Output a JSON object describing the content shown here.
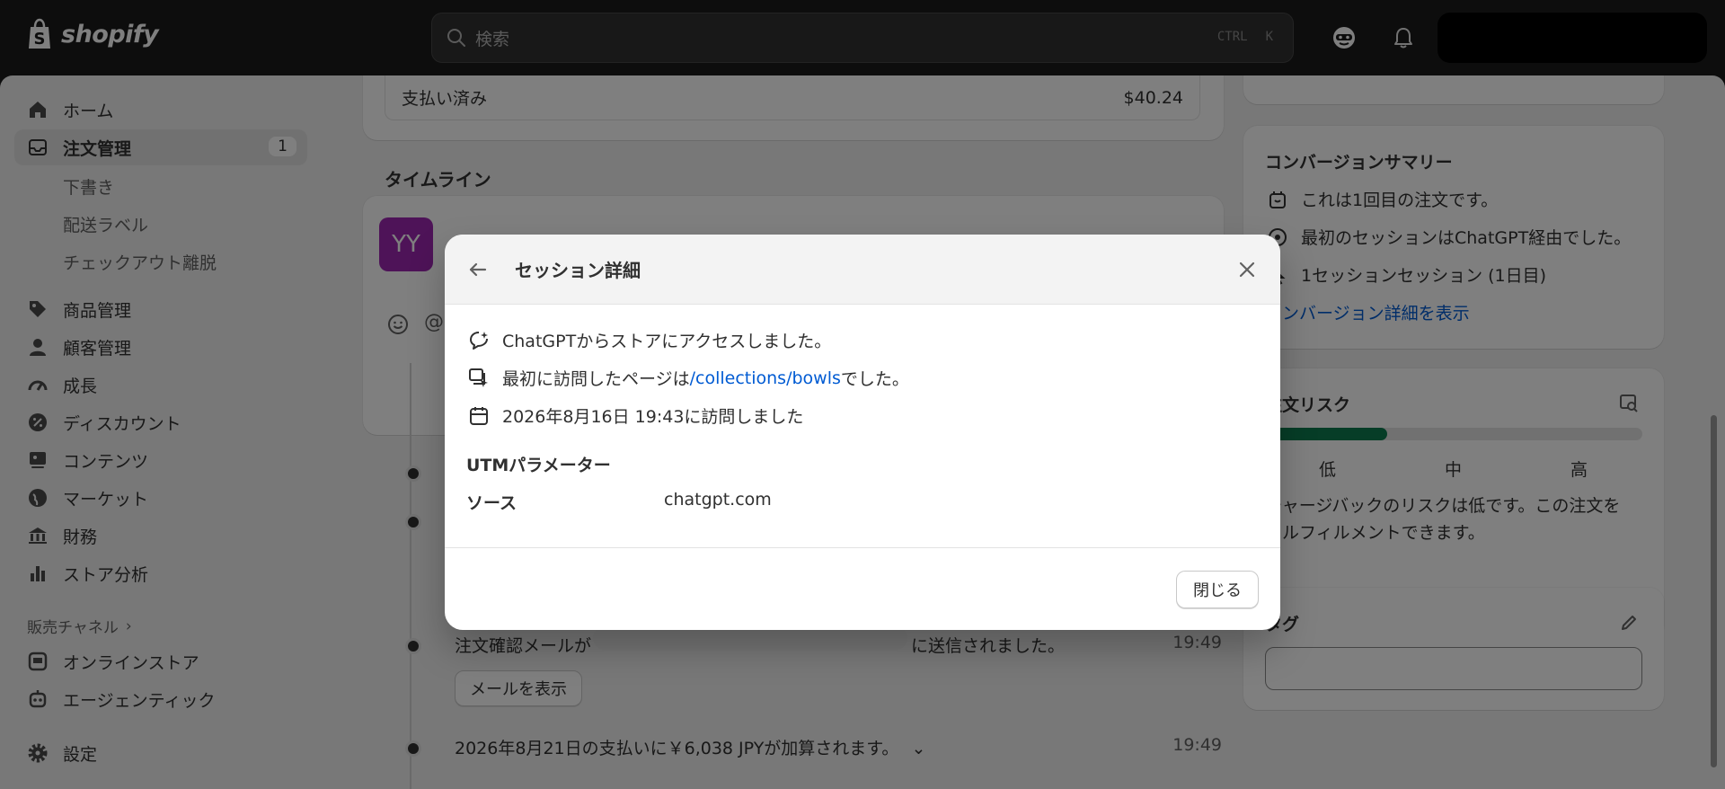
{
  "topbar": {
    "logo_text": "shopify",
    "search_placeholder": "検索",
    "shortcut_ctrl": "CTRL",
    "shortcut_key": "K"
  },
  "sidebar": {
    "home": "ホーム",
    "orders": "注文管理",
    "orders_badge": "1",
    "drafts": "下書き",
    "shipping_labels": "配送ラベル",
    "abandoned_checkouts": "チェックアウト離脱",
    "products": "商品管理",
    "customers": "顧客管理",
    "growth": "成長",
    "discounts": "ディスカウント",
    "content": "コンテンツ",
    "markets": "マーケット",
    "finance": "財務",
    "analytics": "ストア分析",
    "sales_channels": "販売チャネル",
    "online_store": "オンラインストア",
    "agentic": "エージェンティック",
    "settings": "設定"
  },
  "main": {
    "paid_label": "支払い済み",
    "paid_amount": "$40.24",
    "timeline_title": "タイムライン",
    "avatar_initials": "YY",
    "confirm_email_prefix": "注文確認メールが",
    "confirm_email_suffix": "に送信されました。",
    "confirm_email_time": "19:49",
    "view_email_button": "メールを表示",
    "payout_text": "2026年8月21日の支払いに￥6,038 JPYが加算されます。",
    "payout_time": "19:49"
  },
  "right": {
    "conversion_title": "コンバージョンサマリー",
    "conversion_first_order": "これは1回目の注文です。",
    "conversion_first_session": "最初のセッションはChatGPT経由でした。",
    "conversion_sessions": "1セッションセッション (1日目)",
    "conversion_link": "コンバージョン詳細を表示",
    "risk_title": "注文リスク",
    "risk_level": 0.32,
    "risk_low": "低",
    "risk_mid": "中",
    "risk_high": "高",
    "risk_desc_line1": "チャージバックのリスクは低です。この注文を",
    "risk_desc_line2": "フルフィルメントできます。",
    "tags_title": "タグ"
  },
  "modal": {
    "title": "セッション詳細",
    "row1": "ChatGPTからストアにアクセスしました。",
    "row2_prefix": "最初に訪問したページは",
    "row2_link": "/collections/bowls",
    "row2_suffix": "でした。",
    "row3": "2026年8月16日 19:43に訪問しました",
    "utm_title": "UTMパラメーター",
    "utm_source_label": "ソース",
    "utm_source_value": "chatgpt.com",
    "close_button": "閉じる"
  },
  "colors": {
    "link": "#005bd3",
    "avatar": "#9c27b0",
    "risk_fill": "#0d7a4f"
  }
}
